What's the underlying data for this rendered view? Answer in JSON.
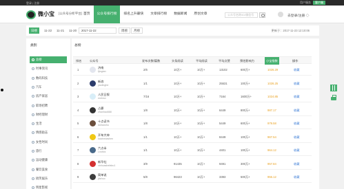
{
  "topbar": {
    "left": "登录 | 注册",
    "right_link": "用户服务",
    "right_button": "客户端"
  },
  "header": {
    "brand": "微小宝",
    "brand_sub": "[公众号分析平台]",
    "nav": [
      "首页",
      "公众号排行榜",
      "排名上升最快",
      "文章排行榜",
      "数据新闻",
      "原创文章"
    ],
    "search_placeholder": "公众号名称/ID/微信号",
    "login": "去登录/注册 ◇"
  },
  "filters": {
    "tabs": [
      "日榜",
      "11-22",
      "11-21",
      "11-20"
    ],
    "date": "2017-11-22",
    "week": "周榜",
    "month": "月榜",
    "update_time": "更新于：2017-11-23 12:10:06"
  },
  "sidebar": {
    "title": "类别",
    "items": [
      "总榜",
      "时事资讯",
      "数码科技",
      "汽车",
      "房产家居",
      "职场招聘",
      "财经理财",
      "生活",
      "情感励志",
      "女性时尚",
      "旅行",
      "运动健康",
      "餐饮美食",
      "搞笑娱乐",
      "明星影视"
    ]
  },
  "main": {
    "title": "总榜",
    "columns": [
      "排名",
      "公众号",
      "发布次数/篇数",
      "头条阅读",
      "平均阅读",
      "平均点赞",
      "预估影响力",
      "小宝指数",
      "操作"
    ],
    "rows": [
      {
        "rank": "1",
        "name": "济南",
        "id": "fjingtan",
        "posts": "2/6",
        "head": "10万+",
        "avg": "10万+",
        "likes": "13102",
        "reach": "600万+",
        "index": "1026.29",
        "action": "收藏"
      },
      {
        "rank": "2",
        "name": "新浪",
        "id": "yaolinghe",
        "posts": "1/1",
        "head": "10万+",
        "avg": "10万+",
        "likes": "25531",
        "reach": "100万+",
        "index": "1026.25",
        "action": "收藏"
      },
      {
        "rank": "3",
        "name": "人民日报",
        "id": "rmrbwx",
        "posts": "7/16",
        "head": "10万+",
        "avg": "10万+",
        "likes": "7164",
        "reach": "1600万+",
        "index": "1024.85",
        "action": "收藏"
      },
      {
        "rank": "4",
        "name": "占豪",
        "id": "zhanhao668",
        "posts": "1/8",
        "head": "10万+",
        "avg": "10万+",
        "likes": "6449",
        "reach": "800万+",
        "index": "987.17",
        "action": "收藏"
      },
      {
        "rank": "5",
        "name": "十点读书",
        "id": "duhaoshu",
        "posts": "1/8",
        "head": "10万+",
        "avg": "10万+",
        "likes": "5449",
        "reach": "600万+",
        "index": "979.58",
        "action": "收藏"
      },
      {
        "rank": "6",
        "name": "开车大神",
        "id": "kaichedashen",
        "posts": "1/1",
        "head": "10万+",
        "avg": "10万+",
        "likes": "8449",
        "reach": "100万+",
        "index": "967.54",
        "action": "收藏"
      },
      {
        "rank": "7",
        "name": "六点半",
        "id": "Lnotick",
        "posts": "1/1",
        "head": "10万+",
        "avg": "10万+",
        "likes": "4401",
        "reach": "100万+",
        "index": "964.12",
        "action": "收藏"
      },
      {
        "rank": "8",
        "name": "新华社",
        "id": "xinhuashefabu1",
        "posts": "3/9",
        "head": "91435",
        "avg": "10万+",
        "likes": "9491",
        "reach": "300万+",
        "index": "957.84",
        "action": "收藏"
      },
      {
        "rank": "9",
        "name": "简单说",
        "id": "jdshuo",
        "posts": "5/8",
        "head": "96423",
        "avg": "10万+",
        "likes": "3393",
        "reach": "500万+",
        "index": "955.12",
        "action": "收藏"
      }
    ]
  },
  "colors": {
    "accent": "#46b06f",
    "index_color": "#e8a020",
    "link_color": "#3a7bd5"
  },
  "avatar_colors": [
    "#e3e6ee",
    "#2b3b6b",
    "#d8eef8",
    "#333333",
    "#6b4e3b",
    "#f0c814",
    "#4a6a8a",
    "#d32f2f",
    "#3d3d3d"
  ]
}
